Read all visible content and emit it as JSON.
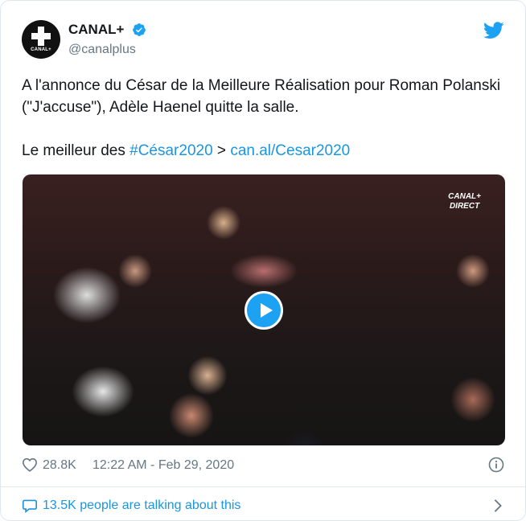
{
  "account": {
    "display_name": "CANAL+",
    "handle": "@canalplus",
    "avatar_text": "CANAL+"
  },
  "tweet": {
    "line1": "A l'annonce du César de la Meilleure Réalisation pour Roman Polanski (\"J'accuse\"), Adèle Haenel quitte la salle.",
    "line2_prefix": "Le meilleur des ",
    "hashtag": "#César2020",
    "arrow": " > ",
    "link": "can.al/Cesar2020"
  },
  "media": {
    "tag_line1": "CANAL+",
    "tag_line2": "DIRECT"
  },
  "stats": {
    "likes": "28.8K",
    "timestamp": "12:22 AM - Feb 29, 2020"
  },
  "footer": {
    "talking": "13.5K people are talking about this"
  },
  "colors": {
    "accent": "#1da1f2",
    "link": "#1b95e0",
    "muted": "#657786"
  }
}
